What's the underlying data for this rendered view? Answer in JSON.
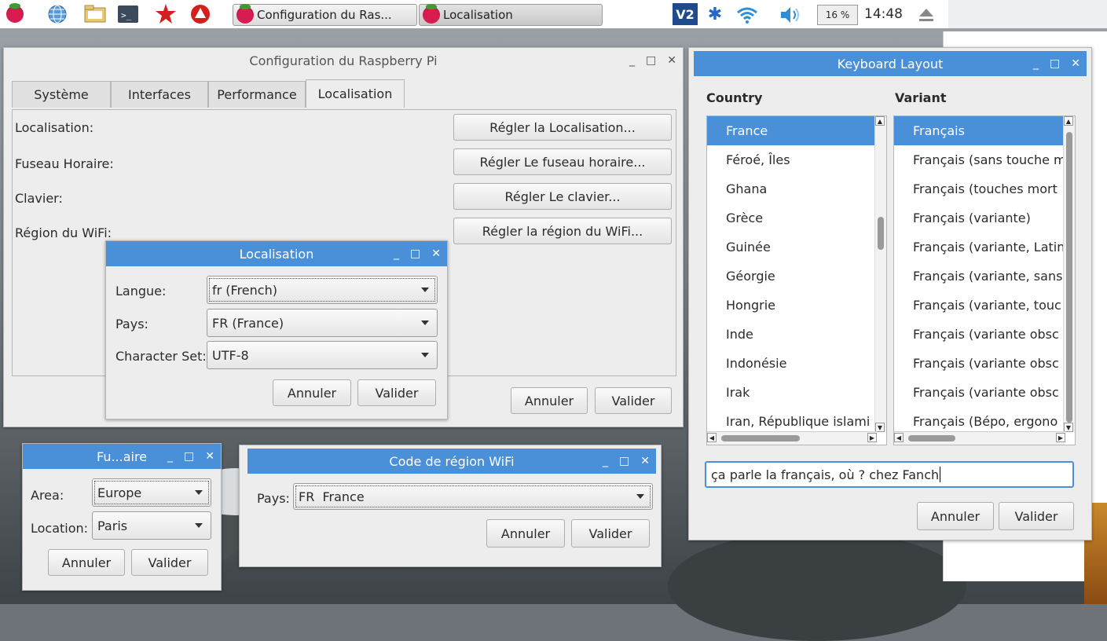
{
  "taskbar": {
    "tasks": [
      {
        "label": "Configuration du Ras..."
      },
      {
        "label": "Localisation"
      }
    ],
    "cpu_percent": "16 %",
    "clock": "14:48"
  },
  "config_window": {
    "title": "Configuration du Raspberry Pi",
    "tabs": [
      "Système",
      "Interfaces",
      "Performance",
      "Localisation"
    ],
    "rows": [
      {
        "label": "Localisation:",
        "button": "Régler la Localisation..."
      },
      {
        "label": "Fuseau Horaire:",
        "button": "Régler Le fuseau horaire..."
      },
      {
        "label": "Clavier:",
        "button": "Régler Le clavier..."
      },
      {
        "label": "Région du WiFi:",
        "button": "Régler la région du WiFi..."
      }
    ],
    "cancel": "Annuler",
    "ok": "Valider"
  },
  "locale_dialog": {
    "title": "Localisation",
    "language_label": "Langue:",
    "language_value": "fr (French)",
    "country_label": "Pays:",
    "country_value": "FR (France)",
    "charset_label": "Character Set:",
    "charset_value": "UTF-8",
    "cancel": "Annuler",
    "ok": "Valider"
  },
  "timezone_dialog": {
    "title": "Fu...aire",
    "area_label": "Area:",
    "area_value": "Europe",
    "location_label": "Location:",
    "location_value": "Paris",
    "cancel": "Annuler",
    "ok": "Valider"
  },
  "wifi_dialog": {
    "title": "Code de région WiFi",
    "country_label": "Pays:",
    "country_value": "FR  France",
    "cancel": "Annuler",
    "ok": "Valider"
  },
  "keyboard_dialog": {
    "title": "Keyboard Layout",
    "country_header": "Country",
    "variant_header": "Variant",
    "countries": [
      "France",
      "Féroé, Îles",
      "Ghana",
      "Grèce",
      "Guinée",
      "Géorgie",
      "Hongrie",
      "Inde",
      "Indonésie",
      "Irak",
      "Iran, République islami"
    ],
    "variants": [
      "Français",
      "Français (sans touche m",
      "Français (touches mort",
      "Français (variante)",
      "Français (variante, Latin",
      "Français (variante, sans",
      "Français (variante, touc",
      "Français (variante obsc",
      "Français (variante obsc",
      "Français (variante obsc",
      "Français (Bépo, ergono"
    ],
    "test_text": "ça parle la français, où ? chez Fanch",
    "cancel": "Annuler",
    "ok": "Valider"
  }
}
